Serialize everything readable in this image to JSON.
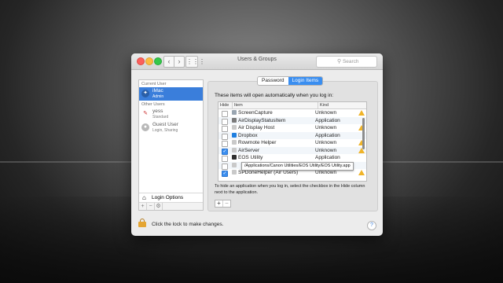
{
  "window": {
    "title": "Users & Groups",
    "search_placeholder": "Search"
  },
  "sidebar": {
    "current_user_header": "Current User",
    "current_user": {
      "name": "iMac",
      "role": "Admin"
    },
    "other_users_header": "Other Users",
    "other_users": [
      {
        "name": "yess",
        "role": "Standard"
      },
      {
        "name": "Guest User",
        "role": "Login, Sharing"
      }
    ],
    "login_options_label": "Login Options",
    "footer_add": "+",
    "footer_remove": "−",
    "footer_gear": "⚙"
  },
  "tabs": [
    {
      "label": "Password",
      "active": false
    },
    {
      "label": "Login Items",
      "active": true
    }
  ],
  "login_items": {
    "description": "These items will open automatically when you log in:",
    "columns": {
      "hide": "Hide",
      "item": "Item",
      "kind": "Kind"
    },
    "rows": [
      {
        "name": "ScreenCapture",
        "kind": "Unknown",
        "hidden": false,
        "warning": true,
        "icon_color": "#9aa6b2"
      },
      {
        "name": "AirDisplayStatusItem",
        "kind": "Application",
        "hidden": false,
        "warning": false,
        "icon_color": "#7b7b7b"
      },
      {
        "name": "Air Display Host",
        "kind": "Unknown",
        "hidden": false,
        "warning": true,
        "icon_color": "#c9c9c9"
      },
      {
        "name": "Dropbox",
        "kind": "Application",
        "hidden": false,
        "warning": false,
        "icon_color": "#1f7fe0"
      },
      {
        "name": "Rowmote Helper",
        "kind": "Unknown",
        "hidden": false,
        "warning": true,
        "icon_color": "#c9c9c9"
      },
      {
        "name": "AirServer",
        "kind": "Unknown",
        "hidden": true,
        "warning": true,
        "icon_color": "#c9c9c9"
      },
      {
        "name": "EOS Utility",
        "kind": "Application",
        "hidden": false,
        "warning": false,
        "icon_color": "#2f2f2f"
      },
      {
        "name": "",
        "kind": "Application",
        "hidden": false,
        "warning": false,
        "icon_color": "#c9c9c9"
      },
      {
        "name": "SPDoneHelper (Air Users)",
        "kind": "Unknown",
        "hidden": true,
        "warning": true,
        "icon_color": "#c9c9c9"
      }
    ],
    "tooltip": "/Applications/Canon Utilities/EOS Utility/EOS Utility.app",
    "hint": "To hide an application when you log in, select the checkbox in the Hide column next to the application.",
    "add_label": "+",
    "remove_label": "−"
  },
  "footer": {
    "lock_text": "Click the lock to make changes.",
    "help_label": "?"
  },
  "colors": {
    "selection": "#3a7edb",
    "warning": "#f0b429",
    "tab_active": "#3a8ef0"
  }
}
